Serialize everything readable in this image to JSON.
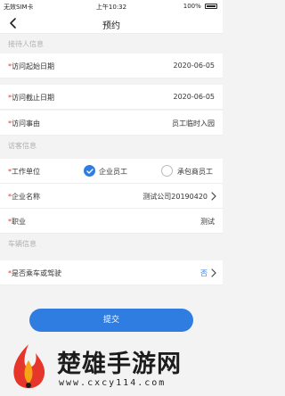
{
  "status_bar": {
    "carrier": "无效SIM卡",
    "time": "上午10:32",
    "battery": "100%"
  },
  "nav": {
    "title": "预约"
  },
  "sections": {
    "receiver": "接待人信息",
    "visitor": "访客信息",
    "vehicle": "车辆信息"
  },
  "form": {
    "start_date": {
      "label": "访问起始日期",
      "value": "2020-06-05"
    },
    "end_date": {
      "label": "访问截止日期",
      "value": "2020-06-05"
    },
    "reason": {
      "label": "访问事由",
      "value": "员工临时入园"
    },
    "unit": {
      "label": "工作单位",
      "options": [
        "企业员工",
        "承包商员工"
      ],
      "selected": "企业员工"
    },
    "company": {
      "label": "企业名称",
      "value": "测试公司20190420"
    },
    "job": {
      "label": "职业",
      "value": "测试"
    },
    "vehicle": {
      "label": "是否乘车或驾驶",
      "value": "否"
    }
  },
  "required_mark": "*",
  "submit_label": "提交",
  "watermark": {
    "title": "楚雄手游网",
    "url": "www.cxcy114.com"
  },
  "colors": {
    "accent": "#2f7de1",
    "required": "#ee3333"
  }
}
